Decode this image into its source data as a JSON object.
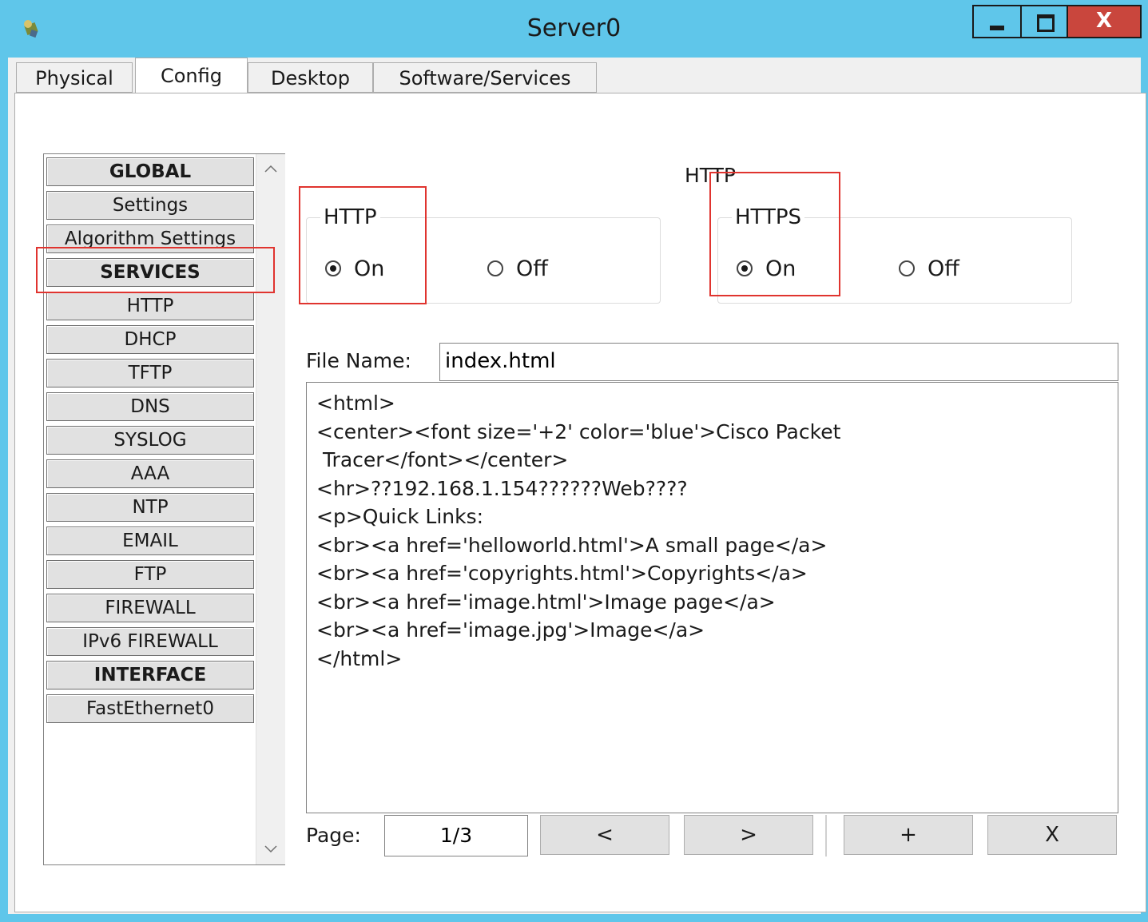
{
  "window": {
    "title": "Server0",
    "close_glyph": "X",
    "colors": {
      "titlebar": "#5fc6ea",
      "close": "#c9463d",
      "annotation": "#e0342f"
    }
  },
  "tabs": [
    {
      "label": "Physical",
      "active": false
    },
    {
      "label": "Config",
      "active": true
    },
    {
      "label": "Desktop",
      "active": false
    },
    {
      "label": "Software/Services",
      "active": false
    }
  ],
  "sidebar": {
    "items": [
      {
        "label": "GLOBAL",
        "header": true
      },
      {
        "label": "Settings",
        "header": false
      },
      {
        "label": "Algorithm Settings",
        "header": false
      },
      {
        "label": "SERVICES",
        "header": true
      },
      {
        "label": "HTTP",
        "header": false,
        "selected": true
      },
      {
        "label": "DHCP",
        "header": false
      },
      {
        "label": "TFTP",
        "header": false
      },
      {
        "label": "DNS",
        "header": false
      },
      {
        "label": "SYSLOG",
        "header": false
      },
      {
        "label": "AAA",
        "header": false
      },
      {
        "label": "NTP",
        "header": false
      },
      {
        "label": "EMAIL",
        "header": false
      },
      {
        "label": "FTP",
        "header": false
      },
      {
        "label": "FIREWALL",
        "header": false
      },
      {
        "label": "IPv6 FIREWALL",
        "header": false
      },
      {
        "label": "INTERFACE",
        "header": true
      },
      {
        "label": "FastEthernet0",
        "header": false
      }
    ],
    "scroll_up_icon": "chevron-up-icon",
    "scroll_down_icon": "chevron-down-icon"
  },
  "main": {
    "section_title": "HTTP",
    "http_group": {
      "legend": "HTTP",
      "on_label": "On",
      "off_label": "Off",
      "selected": "On"
    },
    "https_group": {
      "legend": "HTTPS",
      "on_label": "On",
      "off_label": "Off",
      "selected": "On"
    },
    "file_name_label": "File Name:",
    "file_name_value": "index.html",
    "editor_lines": [
      "<html>",
      "<center><font size='+2' color='blue'>Cisco Packet",
      " Tracer</font></center>",
      "<hr>??192.168.1.154??????Web????",
      "<p>Quick Links:",
      "<br><a href='helloworld.html'>A small page</a>",
      "<br><a href='copyrights.html'>Copyrights</a>",
      "<br><a href='image.html'>Image page</a>",
      "<br><a href='image.jpg'>Image</a>",
      "</html>"
    ],
    "page_label": "Page:",
    "page_value": "1/3",
    "prev_label": "<",
    "next_label": ">",
    "add_label": "+",
    "delete_label": "X"
  }
}
